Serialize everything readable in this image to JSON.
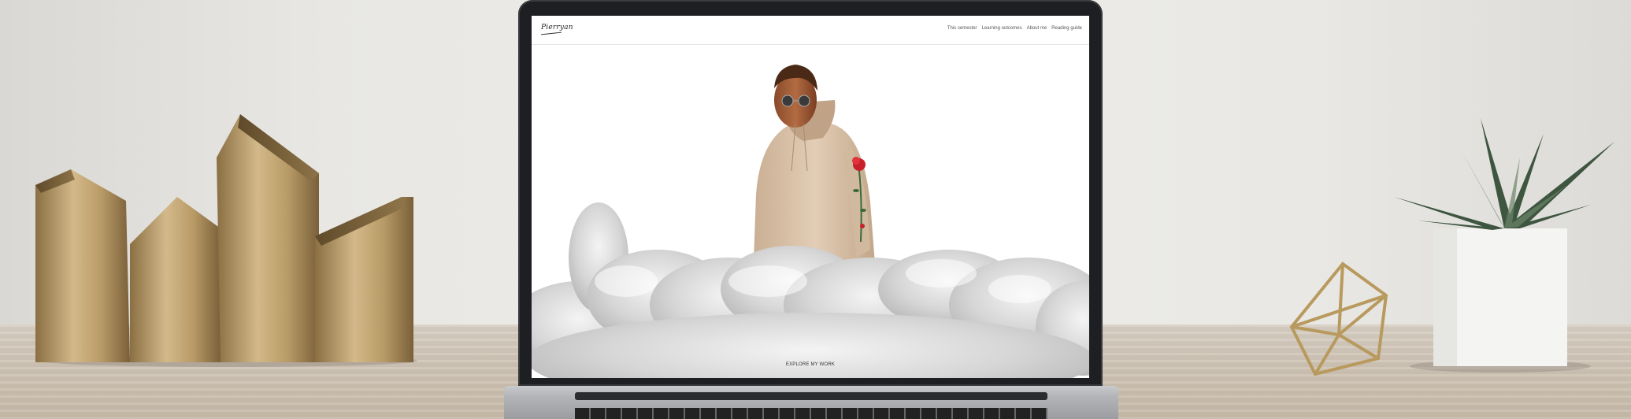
{
  "site": {
    "logo_text": "Pierryan",
    "nav": [
      {
        "label": "This semester"
      },
      {
        "label": "Learning outcomes"
      },
      {
        "label": "About me"
      },
      {
        "label": "Reading guide"
      }
    ],
    "cta_label": "EXPLORE MY WORK"
  },
  "colors": {
    "wall": "#e8e7e3",
    "desk": "#cfc4b6",
    "laptop_bezel": "#1e1f22",
    "hoodie": "#dcc3a8",
    "rose": "#c8202a"
  },
  "icons": [
    "brass-house-ornaments",
    "succulent-plant",
    "brass-geometric-terrarium",
    "laptop"
  ]
}
